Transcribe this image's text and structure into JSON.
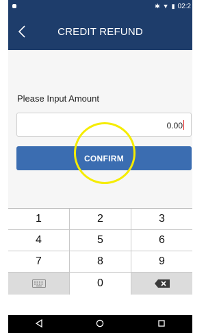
{
  "status_bar": {
    "time": "02:2",
    "icons": [
      "app-dot-icon",
      "bluetooth-icon",
      "wifi-icon",
      "signal-icon"
    ]
  },
  "app_bar": {
    "title": "CREDIT REFUND",
    "back_icon": "chevron-left-icon"
  },
  "form": {
    "amount_label": "Please Input Amount",
    "amount_value": "0.00",
    "confirm_label": "CONFIRM"
  },
  "keypad": {
    "rows": [
      [
        "1",
        "2",
        "3"
      ],
      [
        "4",
        "5",
        "6"
      ],
      [
        "7",
        "8",
        "9"
      ]
    ],
    "zero": "0",
    "left_icon": "keyboard-icon",
    "right_icon": "backspace-icon"
  },
  "nav_bar": {
    "icons": [
      "back-triangle-icon",
      "home-circle-icon",
      "recents-square-icon"
    ]
  },
  "colors": {
    "app_bar": "#1e3d6b",
    "confirm_button": "#3b6db1",
    "highlight_ring": "#f5ec00",
    "cursor": "#e02020"
  }
}
